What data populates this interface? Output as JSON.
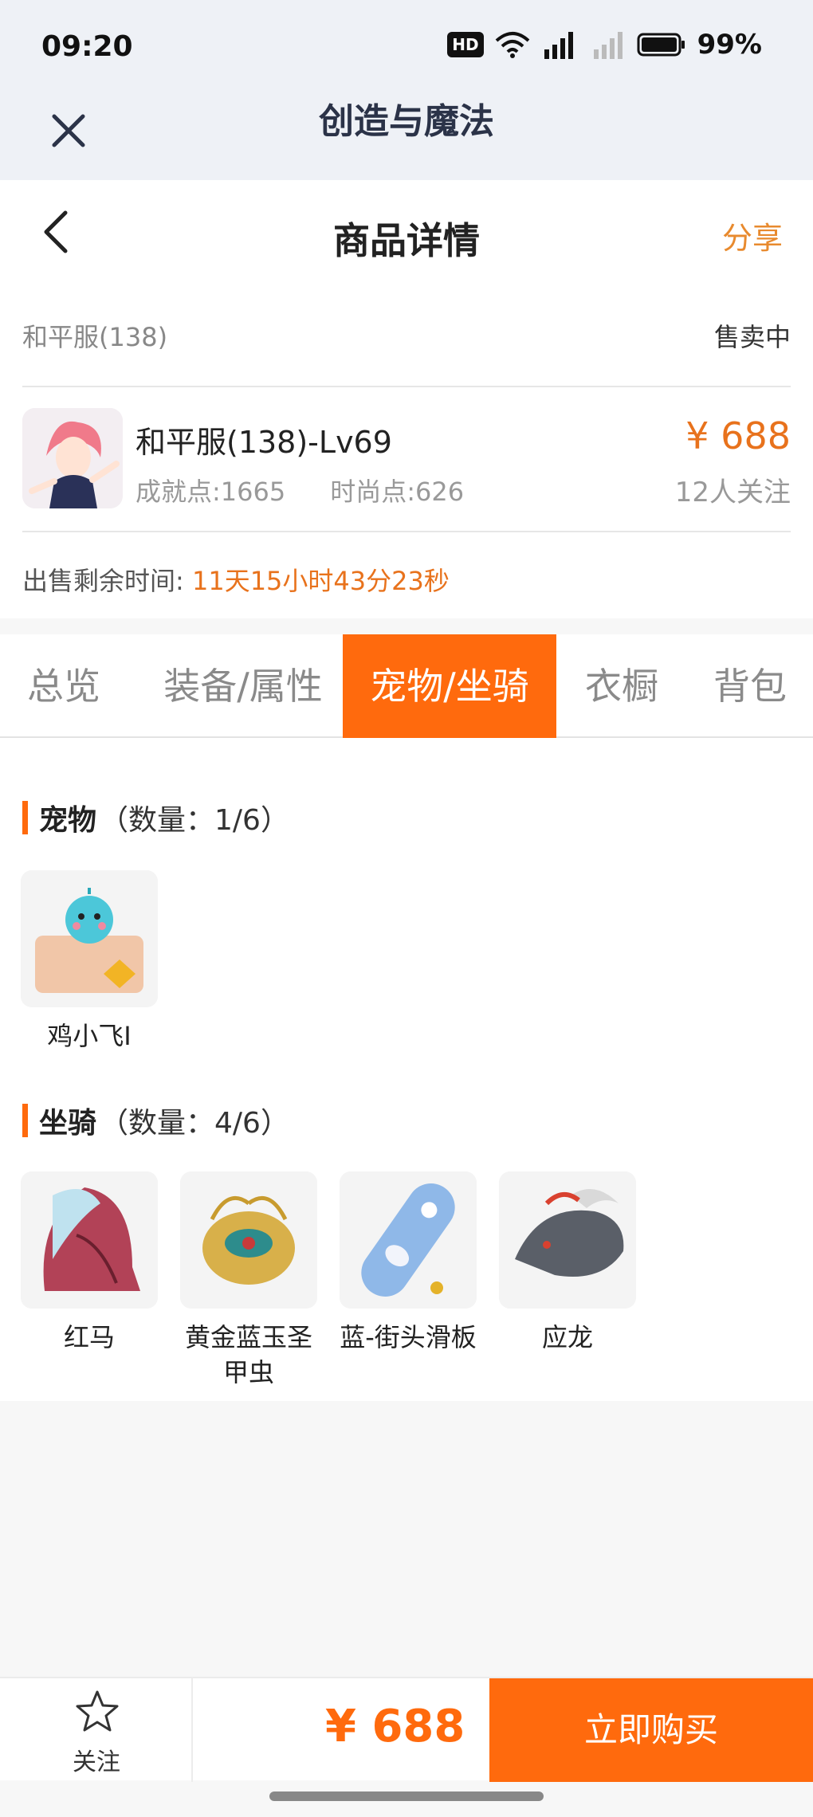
{
  "status_bar": {
    "time": "09:20",
    "hd_label": "HD",
    "battery": "99%"
  },
  "app": {
    "title": "创造与魔法"
  },
  "nav": {
    "title": "商品详情",
    "share": "分享"
  },
  "listing": {
    "server": "和平服(138)",
    "status": "售卖中",
    "role_name": "和平服(138)-Lv69",
    "achievement": "成就点:1665",
    "fashion": "时尚点:626",
    "price": "¥ 688",
    "watchers": "12人关注",
    "remaining_label": "出售剩余时间:",
    "remaining_value": "11天15小时43分23秒"
  },
  "tabs": [
    "总览",
    "装备/属性",
    "宠物/坐骑",
    "衣橱",
    "背包"
  ],
  "active_tab": "宠物/坐骑",
  "pets": {
    "title": "宠物",
    "count": "（数量：1/6）",
    "items": [
      {
        "name": "鸡小飞I"
      }
    ]
  },
  "mounts": {
    "title": "坐骑",
    "count": "（数量：4/6）",
    "items": [
      {
        "name": "红马"
      },
      {
        "name": "黄金蓝玉圣甲虫"
      },
      {
        "name": "蓝-街头滑板"
      },
      {
        "name": "应龙"
      }
    ]
  },
  "bottom": {
    "follow": "关注",
    "price": "¥ 688",
    "buy": "立即购买"
  },
  "colors": {
    "accent": "#ff6a0d",
    "price": "#e8721c"
  }
}
